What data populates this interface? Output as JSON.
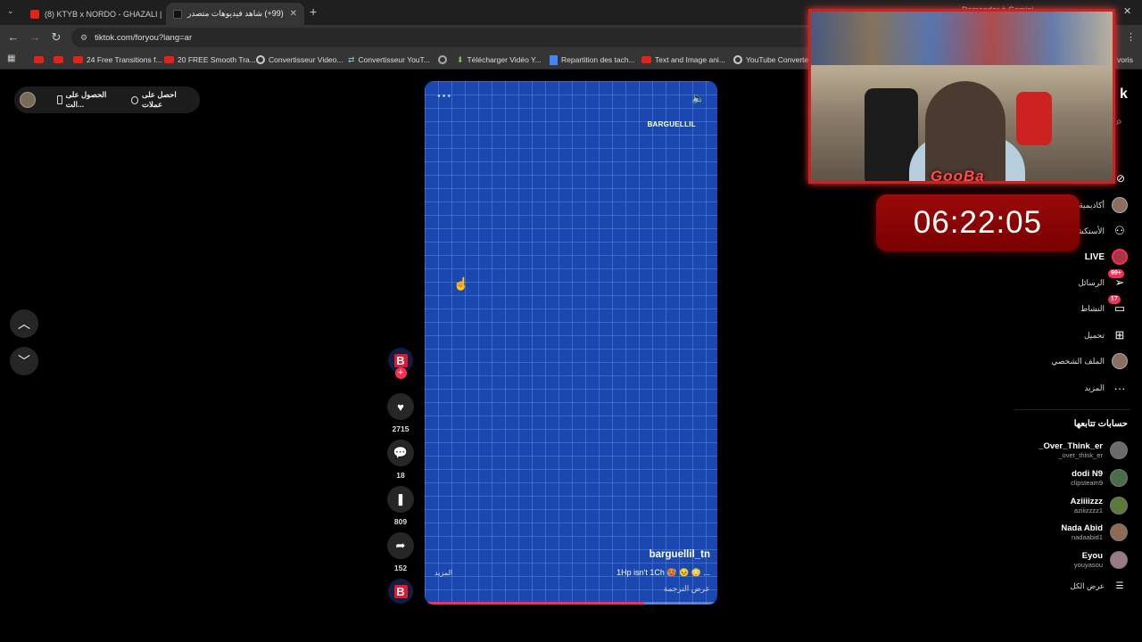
{
  "browser": {
    "tabs": [
      {
        "title": "(8) KTYB x NORDO - GHAZALI |",
        "active": false
      },
      {
        "title": "(99+) شاهد فيديوهات متصدر",
        "active": true
      }
    ],
    "url": "tiktok.com/foryou?lang=ar",
    "bookmarks": [
      "24 Free Transitions f...",
      "20 FREE Smooth Tra...",
      "Convertisseur Video...",
      "Convertisseur YouT...",
      "Télécharger Vidéo Y...",
      "Repartition des tach...",
      "Text and Image ani...",
      "YouTube Converter"
    ],
    "overlay_top": "Demander à Gemini",
    "bookmarks_right": "voris"
  },
  "topbar": {
    "get_coins": "احصل على عملات",
    "get_app": "الحصول على الت..."
  },
  "video": {
    "watermark": "BARGUELLIL",
    "author": "barguellil_tn",
    "caption": "1Hp isn't 1Ch 🥵 😣 😳 ...",
    "more": "المزيد",
    "translate": "عرض الترجمة",
    "progress": 0.75
  },
  "actions": {
    "likes": "2715",
    "comments": "18",
    "saves": "809",
    "shares": "152"
  },
  "sidebar": {
    "logo_partial": "k",
    "items": [
      {
        "label": "أكاديمية",
        "icon": "avatar-icon"
      },
      {
        "label": "الأستكشاف",
        "icon": "users-icon"
      },
      {
        "label": "LIVE",
        "icon": "live-icon"
      },
      {
        "label": "الرسائل",
        "icon": "message-icon",
        "badge": "99+"
      },
      {
        "label": "النشاط",
        "icon": "activity-icon",
        "badge": "17"
      },
      {
        "label": "تحميل",
        "icon": "upload-icon"
      },
      {
        "label": "الملف الشخصي",
        "icon": "profile-icon"
      },
      {
        "label": "المزيد",
        "icon": "more-icon"
      }
    ],
    "following_title": "حسابات تتابعها",
    "accounts": [
      {
        "name": "_Over_Think_er",
        "handle": "_over_think_er",
        "color": "#6b6b6b"
      },
      {
        "name": "dodi N9",
        "handle": "clipsteam9",
        "color": "#4a6e4a"
      },
      {
        "name": "Aziiiizzz",
        "handle": "aziiizzzz1",
        "color": "#5a7a3a"
      },
      {
        "name": "Nada Abid",
        "handle": "nadaabid1",
        "color": "#8e6b55"
      },
      {
        "name": "Eyou",
        "handle": "youyasou",
        "color": "#9a7a85"
      }
    ],
    "see_all": "عرض الكل"
  },
  "stream": {
    "logo": "GooBa",
    "timer": "06:22:05"
  }
}
